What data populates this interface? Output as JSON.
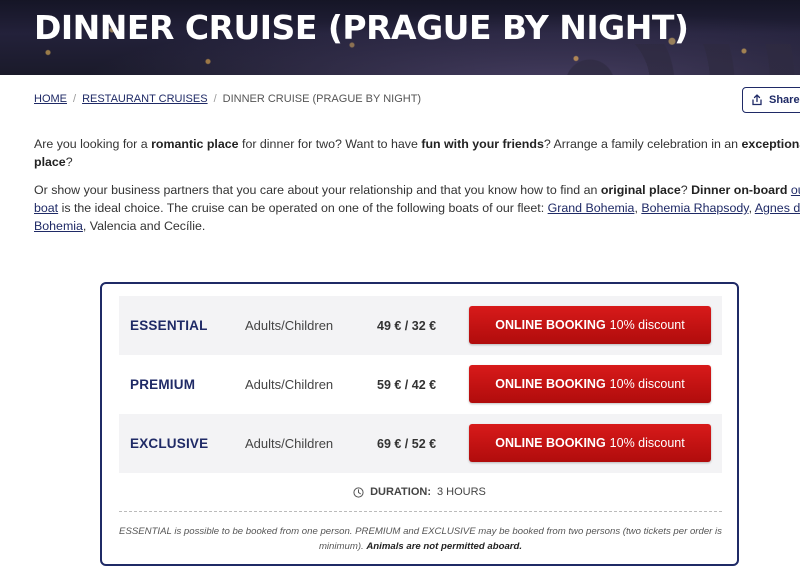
{
  "hero": {
    "title": "DINNER CRUISE (PRAGUE BY NIGHT)"
  },
  "breadcrumb": {
    "items": [
      "HOME",
      "RESTAURANT CRUISES"
    ],
    "current": "DINNER CRUISE (PRAGUE BY NIGHT)",
    "separator": "/"
  },
  "share": {
    "label": "Share",
    "icon": "share-icon"
  },
  "intro": {
    "p1": {
      "t1": "Are you looking for a ",
      "b1": "romantic place",
      "t2": " for dinner for two? Want to have ",
      "b2": "fun with your friends",
      "t3": "? Arrange a family celebration in an ",
      "b3": "exceptional place",
      "t4": "?"
    },
    "p2": {
      "t1": "Or show your business partners that you care about your relationship and that you know how to find an ",
      "b1": "original place",
      "t2": "? ",
      "b2": "Dinner on-board",
      "t3": " ",
      "link1": "our boat",
      "t4": " is the ideal choice. The cruise can be operated on one of the following boats of our fleet: ",
      "link2": "Grand Bohemia",
      "t5": ", ",
      "link3": "Bohemia Rhapsody",
      "t6": ", ",
      "link4": "Agnes de Bohemia",
      "t7": ", Valencia and Cecílie."
    }
  },
  "pricing": {
    "rows": [
      {
        "tier": "ESSENTIAL",
        "persons": "Adults/Children",
        "price": "49 € / 32 €",
        "button_bold": "ONLINE BOOKING",
        "button_rest": "10% discount"
      },
      {
        "tier": "PREMIUM",
        "persons": "Adults/Children",
        "price": "59 € / 42 €",
        "button_bold": "ONLINE BOOKING",
        "button_rest": "10% discount"
      },
      {
        "tier": "EXCLUSIVE",
        "persons": "Adults/Children",
        "price": "69 € / 52 €",
        "button_bold": "ONLINE BOOKING",
        "button_rest": "10% discount"
      }
    ],
    "duration_label": "DURATION:",
    "duration_value": "3 HOURS",
    "note_text": "ESSENTIAL is possible to be booked from one person. PREMIUM and EXCLUSIVE may be booked from two persons (two tickets per order is minimum). ",
    "note_bold": "Animals are not permitted aboard."
  },
  "colors": {
    "brand": "#1f2a66",
    "cta": "#c81313",
    "row_shade": "#f3f3f5"
  }
}
